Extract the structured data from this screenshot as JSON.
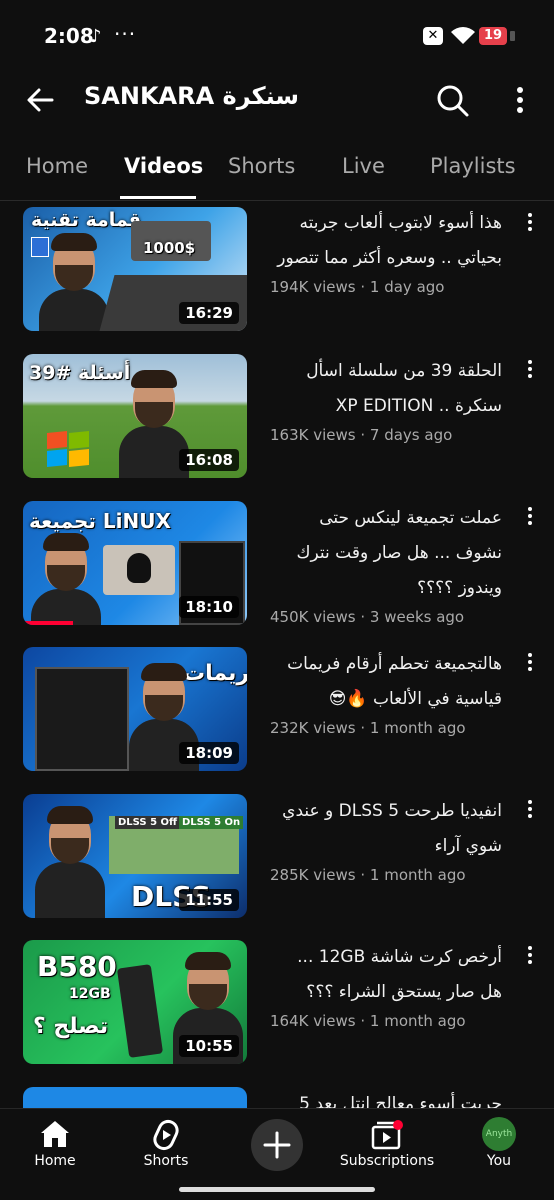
{
  "status_bar": {
    "time": "2:08",
    "tiktok_icon": "♪",
    "dots": "···",
    "battery": "19"
  },
  "header": {
    "title": "SANKARA سنكرة"
  },
  "tabs": [
    {
      "label": "Home"
    },
    {
      "label": "Videos"
    },
    {
      "label": "Shorts"
    },
    {
      "label": "Live"
    },
    {
      "label": "Playlists"
    }
  ],
  "active_tab": "Videos",
  "videos": [
    {
      "title": "هذا أسوء لابتوب ألعاب جربته بحياتي .. وسعره أكثر مما تتصور",
      "views": "194K views",
      "age": "1 day ago",
      "duration": "16:29",
      "thumb_text": "قمامة تقنية",
      "thumb_price": "1000$"
    },
    {
      "title": "الحلقة 39 من سلسلة اسأل سنكرة .. XP EDITION",
      "views": "163K views",
      "age": "7 days ago",
      "duration": "16:08",
      "thumb_text": "أسئلة #39"
    },
    {
      "title": "عملت تجميعة لينكس حتى نشوف ... هل صار وقت نترك ويندوز ؟؟؟؟",
      "views": "450K views",
      "age": "3 weeks ago",
      "duration": "18:10",
      "thumb_text": "تجميعة LiNUX"
    },
    {
      "title": "هالتجميعة تحطم أرقام فريمات قياسية في الألعاب 🔥😎",
      "views": "232K views",
      "age": "1 month ago",
      "duration": "18:09",
      "thumb_text": "ملك الفريمات"
    },
    {
      "title": "انفيديا طرحت DLSS 5 و عندي شوي آراء",
      "views": "285K views",
      "age": "1 month ago",
      "duration": "11:55",
      "thumb_text": "DLSS",
      "thumb_off": "DLSS 5 Off",
      "thumb_on": "DLSS 5 On"
    },
    {
      "title": "أرخص كرت شاشة 12GB ... هل صار يستحق الشراء ؟؟؟",
      "views": "164K views",
      "age": "1 month ago",
      "duration": "10:55",
      "thumb_text": "B580",
      "thumb_sub": "12GB",
      "thumb_q": "تصلح ؟"
    },
    {
      "title": "جربت أسوء معالج انتل بعد 5",
      "views": "",
      "age": "",
      "duration": ""
    }
  ],
  "bottom_nav": [
    {
      "label": "Home"
    },
    {
      "label": "Shorts"
    },
    {
      "label": "Subscriptions"
    },
    {
      "label": "You",
      "avatar_text": "Anyth"
    }
  ],
  "colors": {
    "background": "#0f0f0f",
    "accent": "#ff0033",
    "text": "#f1f1f1",
    "secondary": "#aaaaaa"
  }
}
